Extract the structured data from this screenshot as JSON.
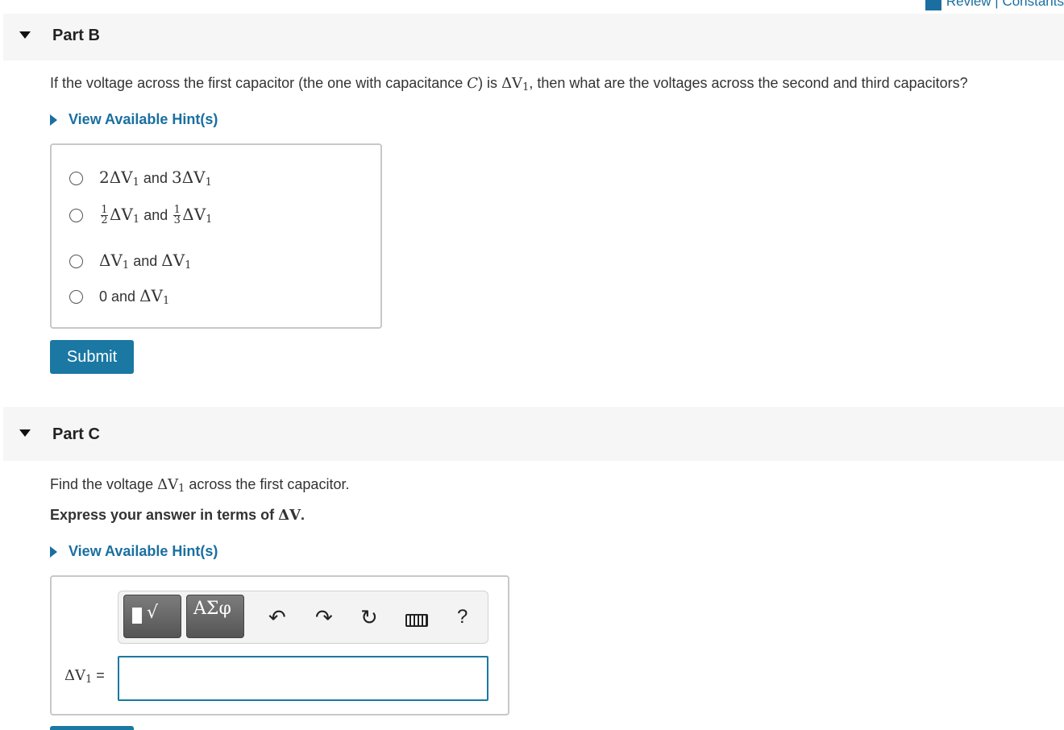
{
  "header": {
    "review_link": "Review | Constants"
  },
  "part_b": {
    "title": "Part B",
    "question_before": "If the voltage across the first capacitor (the one with capacitance ",
    "question_C": "C",
    "question_mid": ") is ",
    "question_dv": "ΔV",
    "question_sub": "1",
    "question_after": ", then what are the voltages across the second and third capacitors?",
    "hint_label": "View Available Hint(s)",
    "and": "and",
    "choices": [
      {
        "a": "2ΔV",
        "a_sub": "1",
        "b": "3ΔV",
        "b_sub": "1"
      },
      {
        "a_num": "1",
        "a_den": "2",
        "a": "ΔV",
        "a_sub": "1",
        "b_num": "1",
        "b_den": "3",
        "b": "ΔV",
        "b_sub": "1"
      },
      {
        "a": "ΔV",
        "a_sub": "1",
        "b": "ΔV",
        "b_sub": "1"
      },
      {
        "a": "0",
        "b": "ΔV",
        "b_sub": "1"
      }
    ],
    "submit_label": "Submit"
  },
  "part_c": {
    "title": "Part C",
    "prompt_before": "Find the voltage ",
    "prompt_dv": "ΔV",
    "prompt_sub": "1",
    "prompt_after": " across the first capacitor.",
    "instruction": "Express your answer in terms of ",
    "instruction_dv": "ΔV",
    "instruction_end": ".",
    "hint_label": "View Available Hint(s)",
    "toolbar": {
      "greek_label": "ΑΣφ",
      "radical_label": "√",
      "undo_icon": "undo-icon",
      "redo_icon": "redo-icon",
      "reset_icon": "reset-icon",
      "keyboard_icon": "keyboard-icon",
      "help_label": "?"
    },
    "answer_label": "ΔV",
    "answer_label_sub": "1",
    "answer_equals": "=",
    "answer_value": ""
  }
}
